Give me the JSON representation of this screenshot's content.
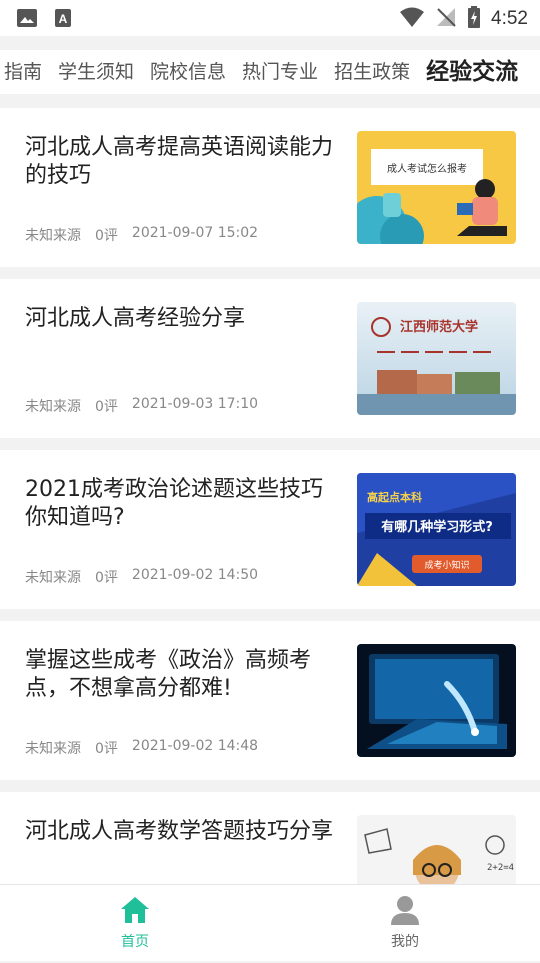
{
  "status_bar": {
    "time": "4:52"
  },
  "tabs": [
    {
      "label": "指南",
      "active": false
    },
    {
      "label": "学生须知",
      "active": false
    },
    {
      "label": "院校信息",
      "active": false
    },
    {
      "label": "热门专业",
      "active": false
    },
    {
      "label": "招生政策",
      "active": false
    },
    {
      "label": "经验交流",
      "active": true
    }
  ],
  "articles": [
    {
      "title": "河北成人高考提高英语阅读能力的技巧",
      "source": "未知来源",
      "comments": "0评",
      "date": "2021-09-07 15:02",
      "thumb_text": "成人考试怎么报考"
    },
    {
      "title": "河北成人高考经验分享",
      "source": "未知来源",
      "comments": "0评",
      "date": "2021-09-03 17:10",
      "thumb_text": "江西师范大学"
    },
    {
      "title": "2021成考政治论述题这些技巧你知道吗?",
      "source": "未知来源",
      "comments": "0评",
      "date": "2021-09-02 14:50",
      "thumb_text_1": "高起点本科",
      "thumb_text_2": "有哪几种学习形式?",
      "thumb_text_3": "成考小知识"
    },
    {
      "title": "掌握这些成考《政治》高频考点，不想拿高分都难!",
      "source": "未知来源",
      "comments": "0评",
      "date": "2021-09-02 14:48"
    },
    {
      "title": "河北成人高考数学答题技巧分享",
      "source": "",
      "comments": "",
      "date": ""
    }
  ],
  "bottom_nav": {
    "home_label": "首页",
    "mine_label": "我的",
    "active_color": "#1fbf9a",
    "inactive_color": "#666666"
  }
}
